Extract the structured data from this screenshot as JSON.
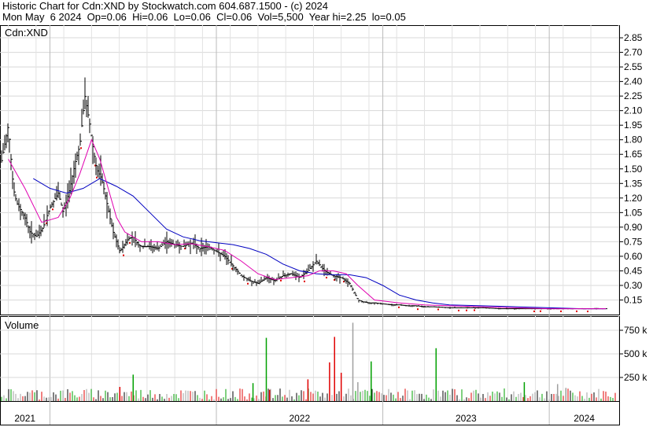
{
  "header": {
    "line1": "Historic Chart for Cdn:XND by Stockwatch.com 604.687.1500 - (c) 2024",
    "line2": "Mon May  6 2024  Op=0.06  Hi=0.06  Lo=0.06  Cl=0.06  Vol=5,500  Year hi=2.25  lo=0.05"
  },
  "chart_data": [
    {
      "type": "line",
      "title": "Cdn:XND",
      "grid": true,
      "y_ticks": [
        "2.85",
        "2.70",
        "2.55",
        "2.40",
        "2.25",
        "2.10",
        "1.95",
        "1.80",
        "1.65",
        "1.50",
        "1.35",
        "1.20",
        "1.05",
        "0.90",
        "0.75",
        "0.60",
        "0.45",
        "0.30",
        "0.15"
      ],
      "ylim": [
        0.0,
        2.98
      ],
      "xlim": [
        2020.7,
        2024.42
      ],
      "x_ticks": [
        "2021",
        "2022",
        "2023",
        "2024"
      ],
      "series": [
        {
          "role": "close",
          "x": [
            2020.7,
            2020.75,
            2020.78,
            2020.8,
            2020.85,
            2020.88,
            2020.92,
            2020.96,
            2021.0,
            2021.05,
            2021.08,
            2021.12,
            2021.15,
            2021.18,
            2021.21,
            2021.24,
            2021.26,
            2021.28,
            2021.31,
            2021.33,
            2021.36,
            2021.38,
            2021.4,
            2021.42,
            2021.44,
            2021.47,
            2021.5,
            2021.53,
            2021.55,
            2021.6,
            2021.65,
            2021.7,
            2021.75,
            2021.8,
            2021.85,
            2021.9,
            2021.95,
            2022.0,
            2022.05,
            2022.1,
            2022.15,
            2022.2,
            2022.25,
            2022.3,
            2022.35,
            2022.4,
            2022.45,
            2022.5,
            2022.55,
            2022.6,
            2022.65,
            2022.7,
            2022.75,
            2022.8,
            2022.85,
            2022.88,
            2022.92,
            2022.95,
            2023.0,
            2023.05,
            2023.1,
            2023.15,
            2023.2,
            2023.25,
            2023.3,
            2023.4,
            2023.5,
            2023.6,
            2023.7,
            2023.8,
            2023.9,
            2024.0,
            2024.1,
            2024.2,
            2024.34
          ],
          "y": [
            1.5,
            1.95,
            1.3,
            1.15,
            1.0,
            0.85,
            0.8,
            0.9,
            1.1,
            1.25,
            1.05,
            1.3,
            1.55,
            1.75,
            2.25,
            1.95,
            1.7,
            1.5,
            1.4,
            1.25,
            1.0,
            0.85,
            0.75,
            0.65,
            0.7,
            0.78,
            0.8,
            0.72,
            0.7,
            0.7,
            0.68,
            0.75,
            0.72,
            0.7,
            0.74,
            0.68,
            0.7,
            0.65,
            0.6,
            0.5,
            0.4,
            0.35,
            0.32,
            0.38,
            0.35,
            0.4,
            0.42,
            0.38,
            0.45,
            0.55,
            0.45,
            0.4,
            0.38,
            0.32,
            0.15,
            0.13,
            0.12,
            0.12,
            0.11,
            0.1,
            0.1,
            0.09,
            0.09,
            0.08,
            0.08,
            0.07,
            0.07,
            0.07,
            0.06,
            0.06,
            0.06,
            0.06,
            0.06,
            0.06,
            0.06
          ]
        },
        {
          "role": "ma_short",
          "x": [
            2020.75,
            2020.85,
            2020.95,
            2021.05,
            2021.12,
            2021.18,
            2021.25,
            2021.3,
            2021.35,
            2021.4,
            2021.45,
            2021.55,
            2021.65,
            2021.75,
            2021.85,
            2021.95,
            2022.05,
            2022.15,
            2022.25,
            2022.35,
            2022.45,
            2022.55,
            2022.62,
            2022.7,
            2022.78,
            2022.85,
            2022.95,
            2023.1,
            2023.25,
            2023.4,
            2023.6,
            2023.8,
            2024.0,
            2024.2,
            2024.34
          ],
          "y": [
            1.6,
            1.3,
            0.95,
            1.0,
            1.2,
            1.45,
            1.8,
            1.6,
            1.3,
            1.0,
            0.85,
            0.75,
            0.75,
            0.72,
            0.73,
            0.7,
            0.66,
            0.55,
            0.42,
            0.36,
            0.38,
            0.4,
            0.45,
            0.45,
            0.42,
            0.3,
            0.15,
            0.12,
            0.1,
            0.09,
            0.08,
            0.07,
            0.06,
            0.06,
            0.06
          ]
        },
        {
          "role": "ma_long",
          "x": [
            2020.9,
            2021.0,
            2021.1,
            2021.2,
            2021.3,
            2021.4,
            2021.5,
            2021.6,
            2021.7,
            2021.8,
            2021.9,
            2022.0,
            2022.1,
            2022.2,
            2022.3,
            2022.4,
            2022.5,
            2022.6,
            2022.7,
            2022.8,
            2022.9,
            2023.0,
            2023.1,
            2023.2,
            2023.3,
            2023.4,
            2023.6,
            2023.8,
            2024.0,
            2024.2,
            2024.34
          ],
          "y": [
            1.4,
            1.3,
            1.25,
            1.3,
            1.4,
            1.32,
            1.22,
            1.05,
            0.88,
            0.8,
            0.76,
            0.74,
            0.72,
            0.68,
            0.62,
            0.52,
            0.45,
            0.42,
            0.41,
            0.41,
            0.38,
            0.3,
            0.2,
            0.15,
            0.12,
            0.1,
            0.09,
            0.08,
            0.07,
            0.06,
            0.06
          ]
        }
      ]
    },
    {
      "type": "bar",
      "title": "Volume",
      "y_ticks": [
        "750 k",
        "500 k",
        "250 k"
      ],
      "ylim": [
        0,
        900000
      ],
      "spikes": [
        {
          "x": 2021.42,
          "v": 150000
        },
        {
          "x": 2021.5,
          "v": 280000
        },
        {
          "x": 2022.22,
          "v": 190000
        },
        {
          "x": 2022.3,
          "v": 670000
        },
        {
          "x": 2022.32,
          "v": 120000
        },
        {
          "x": 2022.55,
          "v": 230000
        },
        {
          "x": 2022.68,
          "v": 410000
        },
        {
          "x": 2022.71,
          "v": 680000
        },
        {
          "x": 2022.75,
          "v": 300000
        },
        {
          "x": 2022.82,
          "v": 830000
        },
        {
          "x": 2022.85,
          "v": 200000
        },
        {
          "x": 2022.93,
          "v": 420000
        },
        {
          "x": 2023.32,
          "v": 560000
        },
        {
          "x": 2023.85,
          "v": 200000
        },
        {
          "x": 2024.05,
          "v": 180000
        },
        {
          "x": 2024.1,
          "v": 140000
        }
      ]
    }
  ]
}
